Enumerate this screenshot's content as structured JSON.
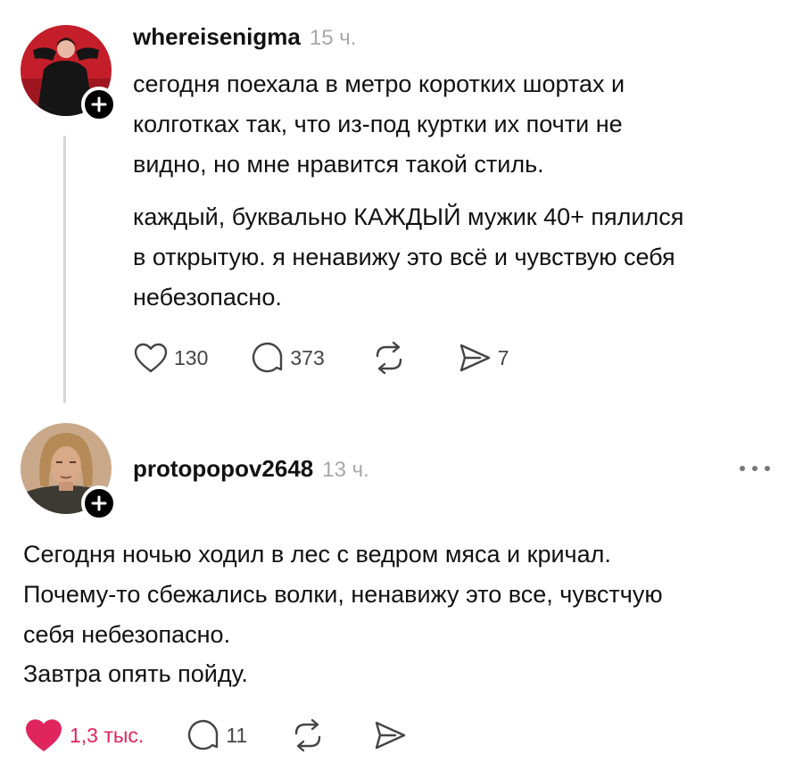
{
  "posts": [
    {
      "username": "whereisenigma",
      "time": "15 ч.",
      "paragraphs": [
        [
          "сегодня поехала в метро коротких шортах и",
          "колготках так, что из-под куртки их почти не",
          "видно, но мне нравится такой стиль."
        ],
        [
          "каждый, буквально КАЖДЫЙ мужик 40+ пялился",
          "в открытую. я ненавижу это всё и чувствую себя",
          "небезопасно."
        ]
      ],
      "stats": {
        "likes": "130",
        "comments": "373",
        "reposts": "",
        "shares": "7"
      },
      "liked": false
    },
    {
      "username": "protopopov2648",
      "time": "13 ч.",
      "paragraphs": [
        [
          "Сегодня ночью ходил в лес с ведром мяса и кричал.",
          "Почему-то сбежались волки, ненавижу это все, чувстчую",
          "себя небезопасно."
        ],
        [
          "Завтра опять пойду."
        ]
      ],
      "stats": {
        "likes": "1,3 тыс.",
        "comments": "11",
        "reposts": "",
        "shares": ""
      },
      "liked": true
    }
  ],
  "colors": {
    "like_active": "#e0245e",
    "muted_text": "#a8a8a8",
    "icon": "#444444"
  },
  "icons": {
    "like": "heart-icon",
    "comment": "comment-bubble-icon",
    "repost": "repost-icon",
    "share": "send-icon",
    "follow": "plus-icon",
    "more": "more-dots-icon"
  }
}
